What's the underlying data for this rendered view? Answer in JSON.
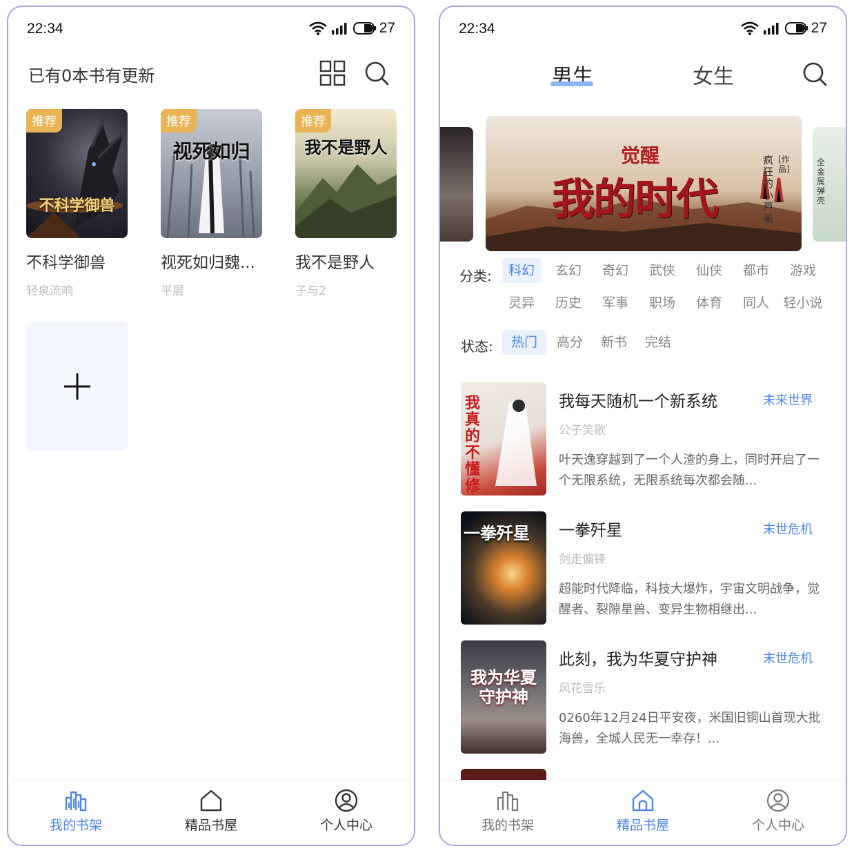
{
  "status": {
    "time": "22:34",
    "battery": "27"
  },
  "left": {
    "update_text": "已有0本书有更新",
    "books": [
      {
        "tag": "推荐",
        "cover_title": "不科学御兽",
        "title": "不科学御兽",
        "author": "轻泉流响"
      },
      {
        "tag": "推荐",
        "cover_title": "视死如归",
        "title": "视死如归魏...",
        "author": "平层"
      },
      {
        "tag": "推荐",
        "cover_title": "我不是野人",
        "title": "我不是野人",
        "author": "子与2"
      }
    ],
    "add_symbol": "+"
  },
  "right": {
    "tabs": {
      "male": "男生",
      "female": "女生"
    },
    "banner": {
      "overline": "觉醒",
      "main_title": "我的时代",
      "side_text": "疯狂的小芦苇",
      "side_tag": "[作品]",
      "right_peek": "全金属弹壳"
    },
    "category_label": "分类:",
    "categories": [
      "科幻",
      "玄幻",
      "奇幻",
      "武侠",
      "仙侠",
      "都市",
      "游戏",
      "灵异",
      "历史",
      "军事",
      "职场",
      "体育",
      "同人",
      "轻小说"
    ],
    "status_label": "状态:",
    "statuses": [
      "热门",
      "高分",
      "新书",
      "完结"
    ],
    "list": [
      {
        "title": "我每天随机一个新系统",
        "category": "未来世界",
        "author": "公子笑歌",
        "desc": "叶天逸穿越到了一个人渣的身上，同时开启了一个无限系统，无限系统每次都会随...",
        "cover_text": "我真的不懂修真"
      },
      {
        "title": "一拳歼星",
        "category": "末世危机",
        "author": "剑走偏锋",
        "desc": "超能时代降临，科技大爆炸，宇宙文明战争，觉醒者、裂隙星兽、变异生物相继出...",
        "cover_text": "一拳歼星"
      },
      {
        "title": "此刻，我为华夏守护神",
        "category": "末世危机",
        "author": "风花雪乐",
        "desc": "0260年12月24日平安夜，米国旧铜山首现大批海兽，全城人民无一幸存！...",
        "cover_text": "我为华夏守护神"
      }
    ]
  },
  "nav": {
    "shelf": "我的书架",
    "store": "精品书屋",
    "me": "个人中心"
  },
  "colors": {
    "accent": "#4a86e8",
    "tag": "#e8b454",
    "frame": "#a9a4dc"
  }
}
